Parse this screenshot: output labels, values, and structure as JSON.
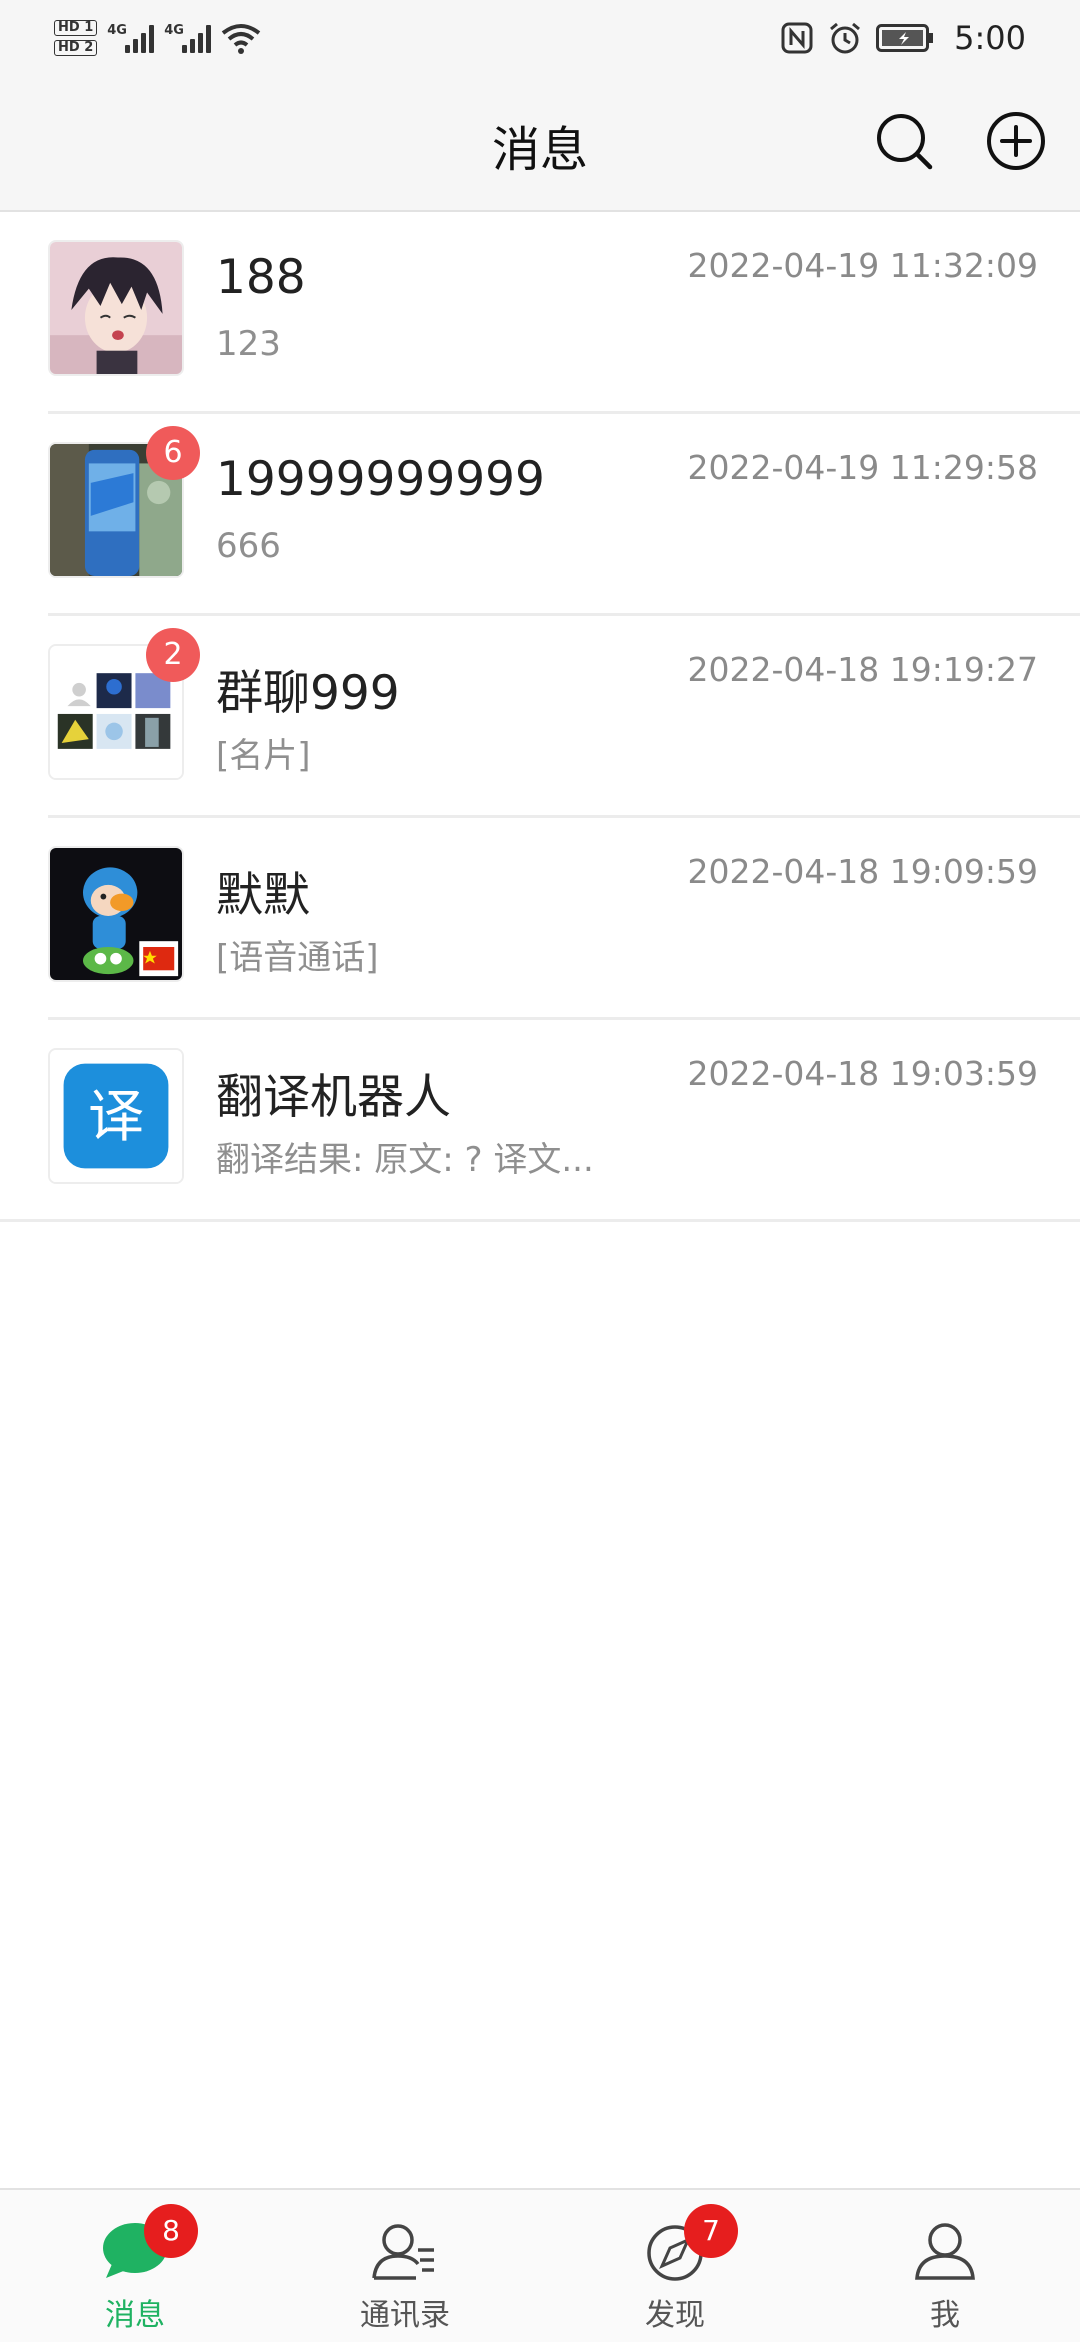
{
  "status_bar": {
    "hd1": "HD 1",
    "hd2": "HD 2",
    "net1": "4G",
    "net2": "4G",
    "time": "5:00"
  },
  "header": {
    "title": "消息"
  },
  "conversations": [
    {
      "name": "188",
      "preview": "123",
      "time": "2022-04-19 11:32:09",
      "badge": ""
    },
    {
      "name": "19999999999",
      "preview": "666",
      "time": "2022-04-19 11:29:58",
      "badge": "6"
    },
    {
      "name": "群聊999",
      "preview": "[名片]",
      "time": "2022-04-18 19:19:27",
      "badge": "2"
    },
    {
      "name": "默默",
      "preview": "[语音通话]",
      "time": "2022-04-18 19:09:59",
      "badge": ""
    },
    {
      "name": "翻译机器人",
      "preview": "翻译结果:   原文: ?   译文...",
      "time": "2022-04-18 19:03:59",
      "badge": "",
      "avatar_text": "译"
    }
  ],
  "bottom_nav": [
    {
      "label": "消息",
      "icon": "chat-bubble-icon",
      "badge": "8",
      "active": true
    },
    {
      "label": "通讯录",
      "icon": "contacts-icon",
      "badge": ""
    },
    {
      "label": "发现",
      "icon": "compass-icon",
      "badge": "7"
    },
    {
      "label": "我",
      "icon": "person-icon",
      "badge": ""
    }
  ],
  "colors": {
    "accent": "#1fb262",
    "badge": "#f05a5a",
    "nav_badge": "#e61e1e",
    "translate_icon_bg": "#1d8fdc"
  }
}
